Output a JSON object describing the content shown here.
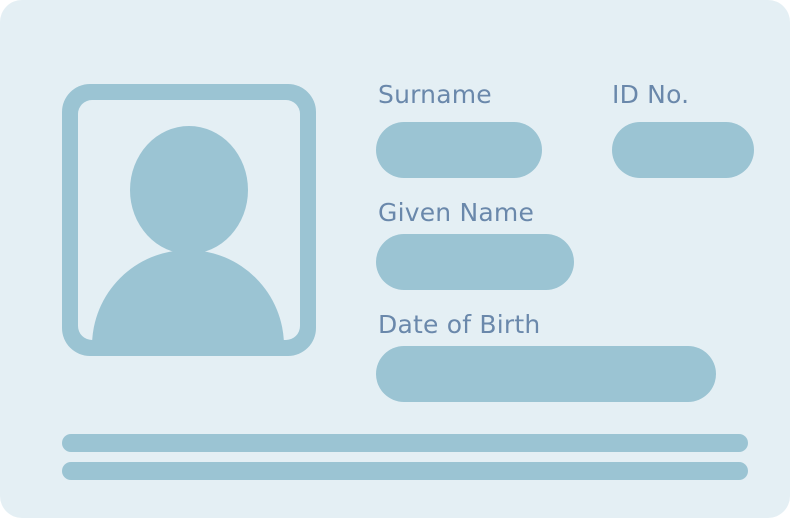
{
  "colors": {
    "card_background": "#e4eff4",
    "accent": "#9bc4d3",
    "label_text": "#6a88ab"
  },
  "photo": {
    "icon": "person-silhouette-icon"
  },
  "fields": {
    "surname": {
      "label": "Surname",
      "value": ""
    },
    "id_no": {
      "label": "ID No.",
      "value": ""
    },
    "given_name": {
      "label": "Given Name",
      "value": ""
    },
    "date_of_birth": {
      "label": "Date of Birth",
      "value": ""
    }
  }
}
